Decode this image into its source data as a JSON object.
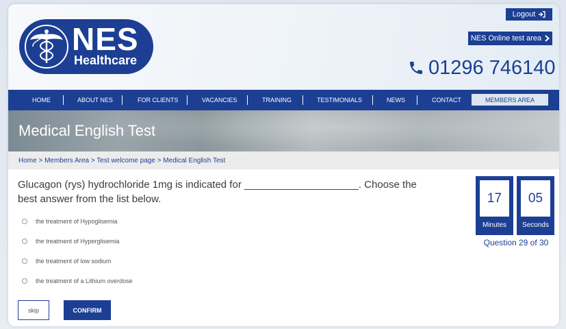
{
  "header": {
    "logo_text": "NES",
    "logo_subtext": "Healthcare",
    "logout_label": "Logout",
    "test_area_label": "NES Online test area",
    "phone": "01296 746140"
  },
  "nav": {
    "items": [
      "HOME",
      "ABOUT NES",
      "FOR CLIENTS",
      "VACANCIES",
      "TRAINING",
      "TESTIMONIALS",
      "NEWS",
      "CONTACT"
    ],
    "members_label": "MEMBERS AREA"
  },
  "banner": {
    "title": "Medical English Test"
  },
  "breadcrumb": {
    "text": "Home > Members Area > Test welcome page > Medical English Test"
  },
  "question": {
    "text": "Glucagon (rys) hydrochloride 1mg is indicated for ____________________. Choose the best answer from the list below.",
    "options": [
      "the treatment of Hypoglisemia",
      "the treatment of Hyperglisemia",
      "the treatment of low sodium",
      "the treatment of a Lithium overdose"
    ]
  },
  "actions": {
    "skip_label": "skip",
    "confirm_label": "CONFIRM"
  },
  "timer": {
    "minutes": "17",
    "minutes_label": "Minutes",
    "seconds": "05",
    "seconds_label": "Seconds"
  },
  "progress": {
    "text": "Question 29 of 30"
  },
  "colors": {
    "brand": "#1c3f94",
    "members_bg": "#dce6f0",
    "breadcrumb_bg": "#ececec"
  }
}
